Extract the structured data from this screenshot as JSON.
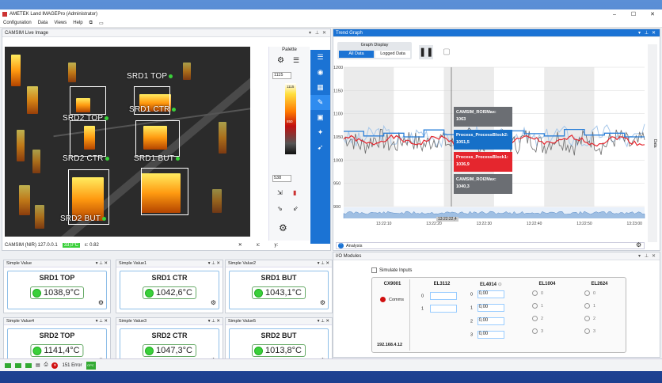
{
  "window": {
    "title": "AMETEK Land IMAGEPro (Administrator)"
  },
  "menu": [
    "Configuration",
    "Data",
    "Views",
    "Help"
  ],
  "cam": {
    "panel_title": "CAMSIM Live Image",
    "rois": [
      {
        "label": "SRD1 TOP"
      },
      {
        "label": "SRD1 CTR"
      },
      {
        "label": "SRD1 BUT"
      },
      {
        "label": "SRD2 TOP"
      },
      {
        "label": "SRD2 CTR"
      },
      {
        "label": "SRD2 BUT"
      }
    ],
    "status": {
      "name": "CAMSIM (NIR) 127.0.0.1",
      "temp": "33,0°C",
      "emissivity": "ε: 0.82"
    },
    "palette": {
      "title": "Palette",
      "top": "1115",
      "bottom": "538",
      "scale_hi": "1115",
      "scale_mid": "850"
    }
  },
  "simple_values": [
    {
      "header": "Simple Value",
      "label": "SRD1 TOP",
      "value": "1038,9°C"
    },
    {
      "header": "Simple Value1",
      "label": "SRD1 CTR",
      "value": "1042,6°C"
    },
    {
      "header": "Simple Value2",
      "label": "SRD1 BUT",
      "value": "1043,1°C"
    },
    {
      "header": "Simple Value4",
      "label": "SRD2 TOP",
      "value": "1141,4°C"
    },
    {
      "header": "Simple Value3",
      "label": "SRD2 CTR",
      "value": "1047,3°C"
    },
    {
      "header": "Simple Value5",
      "label": "SRD2 BUT",
      "value": "1013,8°C"
    }
  ],
  "trend": {
    "panel_title": "Trend Graph",
    "graph_display": "Graph Display",
    "tabs": [
      "All Data",
      "Logged Data"
    ],
    "side_tab": "Data",
    "analysis": "Analysis",
    "y_ticks": [
      "1200",
      "1150",
      "1100",
      "1050",
      "1000",
      "950",
      "900"
    ],
    "x_ticks": [
      "13:22:10",
      "13:22:20",
      "13:22:30",
      "13:22:40",
      "13:22:50",
      "13:23:00"
    ],
    "cursor_time": "13:22:22,4",
    "tooltips": [
      {
        "name": "CAMSIM_ROI5Max:",
        "value": "1063",
        "color": "#6b6e73"
      },
      {
        "name": "Process_ProcessBlock2:",
        "value": "1051,5",
        "color": "#1670c8"
      },
      {
        "name": "Process_ProcessBlock1:",
        "value": "1036,9",
        "color": "#e5262e"
      },
      {
        "name": "CAMSIM_ROI2Max:",
        "value": "1040,3",
        "color": "#6b6e73"
      }
    ],
    "colors": {
      "blue": "#2a7fd8",
      "red": "#e5262e",
      "gray": "#6d6d6d",
      "light": "#a8c8ea"
    }
  },
  "io": {
    "panel_title": "I/O Modules",
    "simulate": "Simulate Inputs",
    "cx": {
      "name": "CX9001",
      "comms": "Comms",
      "ip": "192.168.4.12"
    },
    "el3112": {
      "name": "EL3112",
      "rows": [
        "0",
        "1"
      ]
    },
    "el4014": {
      "name": "EL4014",
      "rows": [
        {
          "n": "0",
          "v": "0,00"
        },
        {
          "n": "1",
          "v": "0,00"
        },
        {
          "n": "2",
          "v": "0,00"
        },
        {
          "n": "3",
          "v": "0,00"
        }
      ]
    },
    "el1004": {
      "name": "EL1004",
      "rows": [
        "0",
        "1",
        "2",
        "3"
      ]
    },
    "el2624": {
      "name": "EL2624",
      "rows": [
        "0",
        "1",
        "2",
        "3"
      ]
    }
  },
  "status": {
    "errors": "151 Error"
  }
}
